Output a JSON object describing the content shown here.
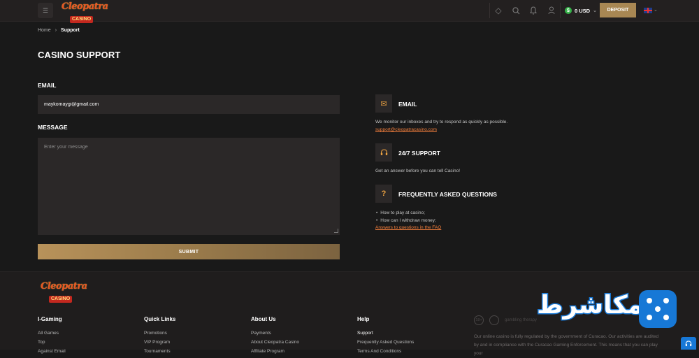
{
  "header": {
    "logo_top": "Cleopatra",
    "logo_bottom": "CASINO",
    "balance": "0 USD",
    "deposit_label": "DEPOSIT",
    "icons": [
      "menu-icon",
      "diamond-icon",
      "search-icon",
      "bell-icon",
      "user-icon",
      "dollar-coin-icon",
      "uk-flag-icon"
    ]
  },
  "breadcrumb": {
    "home": "Home",
    "current": "Support"
  },
  "page": {
    "title": "CASINO SUPPORT"
  },
  "form": {
    "email_label": "EMAIL",
    "email_value": "maykomaygi@gmail.com",
    "message_label": "MESSAGE",
    "message_placeholder": "Enter your message",
    "submit_label": "SUBMIT"
  },
  "info": {
    "email": {
      "title": "EMAIL",
      "text": "We monitor our inboxes and try to respond as quickly as possible.",
      "link": "support@cleopatracasino.com"
    },
    "support": {
      "title": "24/7 SUPPORT",
      "text": "Get an answer before you can tell Casino!"
    },
    "faq": {
      "title": "FREQUENTLY ASKED QUESTIONS",
      "items": [
        "How to play at casino;",
        "How can I withdraw money;"
      ],
      "link": "Answers to questions in the FAQ"
    }
  },
  "footer": {
    "columns": [
      {
        "title": "I-Gaming",
        "items": [
          "All Games",
          "Top",
          "Against Email"
        ]
      },
      {
        "title": "Quick Links",
        "items": [
          "Promotions",
          "VIP Program",
          "Tournaments"
        ]
      },
      {
        "title": "About Us",
        "items": [
          "Payments",
          "About Cleopatra Casino",
          "Affiliate Program"
        ]
      },
      {
        "title": "Help",
        "items": [
          "Support",
          "Frequently Asked Questions",
          "Terms And Conditions"
        ]
      }
    ],
    "badges": {
      "age": "18+",
      "gambling": "gambling therapy"
    },
    "text": "Our online casino is fully regulated by the government of Curacao. Our activities are audited by and in compliance with the Curacao Gaming Enforcement. This means that you can play your"
  },
  "watermark": {
    "text": "ضامکاشرط"
  }
}
